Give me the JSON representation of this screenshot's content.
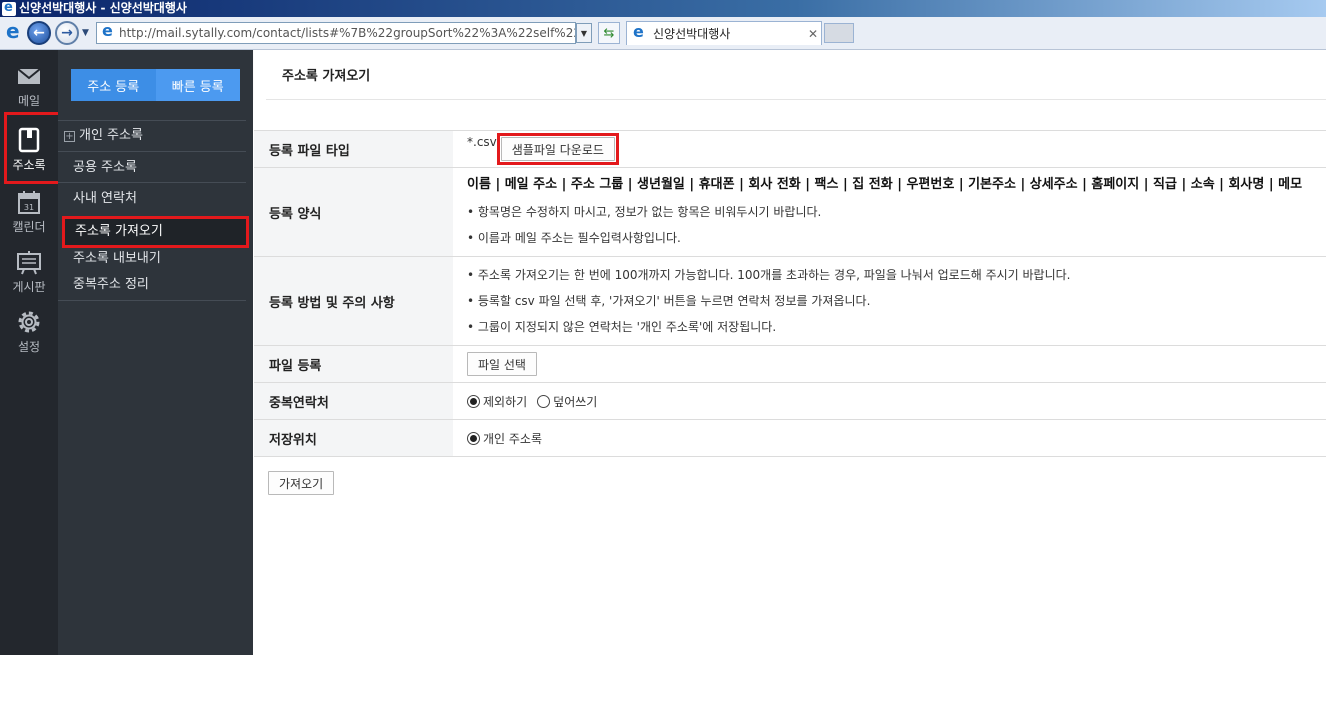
{
  "window": {
    "title": "신양선박대행사 - 신양선박대행사"
  },
  "browser": {
    "address": "http://mail.sytally.com/contact/lists#%7B%22groupSort%22%3A%22self%22",
    "tab_title": "신양선박대행사",
    "tab_close": "✕"
  },
  "rail": {
    "items": [
      {
        "label": "메일",
        "icon": "mail-icon"
      },
      {
        "label": "주소록",
        "icon": "address-book-icon"
      },
      {
        "label": "캘린더",
        "icon": "calendar-icon",
        "badge": "31"
      },
      {
        "label": "게시판",
        "icon": "board-icon"
      },
      {
        "label": "설정",
        "icon": "settings-icon"
      }
    ]
  },
  "subnav": {
    "register_label": "주소 등록",
    "quick_register_label": "빠른 등록",
    "tree_toggle": "+",
    "items": [
      {
        "label": "개인 주소록"
      },
      {
        "label": "공용 주소록"
      },
      {
        "label": "사내 연락처"
      },
      {
        "label": "주소록 가져오기"
      },
      {
        "label": "주소록 내보내기"
      },
      {
        "label": "중복주소 정리"
      }
    ]
  },
  "page": {
    "title": "주소록 가져오기"
  },
  "form": {
    "file_type": {
      "label": "등록 파일 타입",
      "ext": "*.csv",
      "download_label": "샘플파일 다운로드"
    },
    "format": {
      "label": "등록 양식",
      "fields": "이름 | 메일 주소 | 주소 그룹 | 생년월일 | 휴대폰 | 회사 전화 | 팩스 | 집 전화 | 우편번호 | 기본주소 | 상세주소 | 홈페이지 | 직급 | 소속 | 회사명 | 메모",
      "notes": [
        "• 항목명은 수정하지 마시고, 정보가 없는 항목은 비워두시기 바랍니다.",
        "• 이름과 메일 주소는 필수입력사항입니다."
      ]
    },
    "method": {
      "label": "등록 방법 및 주의 사항",
      "notes": [
        "• 주소록 가져오기는 한 번에 100개까지 가능합니다. 100개를 초과하는 경우, 파일을 나눠서 업로드해 주시기 바랍니다.",
        "• 등록할 csv 파일 선택 후, '가져오기' 버튼을 누르면 연락처 정보를 가져옵니다.",
        "• 그룹이 지정되지 않은 연락처는 '개인 주소록'에 저장됩니다."
      ]
    },
    "file_register": {
      "label": "파일 등록",
      "button": "파일 선택"
    },
    "duplicate": {
      "label": "중복연락처",
      "options": [
        {
          "label": "제외하기",
          "selected": true
        },
        {
          "label": "덮어쓰기",
          "selected": false
        }
      ]
    },
    "save_location": {
      "label": "저장위치",
      "options": [
        {
          "label": "개인 주소록",
          "selected": true
        }
      ]
    },
    "import_button": "가져오기"
  },
  "colors": {
    "rail_bg": "#23272d",
    "subnav_bg": "#2e343b",
    "accent_blue": "#3d8ee6",
    "highlight_red": "#e3191c"
  }
}
